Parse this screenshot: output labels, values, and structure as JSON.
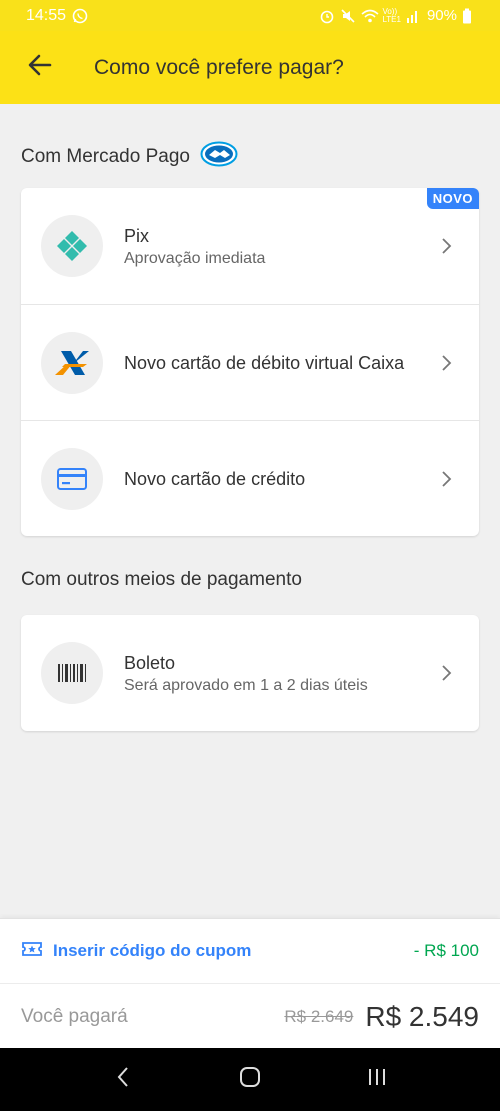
{
  "status_bar": {
    "time": "14:55",
    "battery": "90%",
    "signal_label": "Vo))\nLTE1"
  },
  "app_bar": {
    "title": "Como você prefere pagar?"
  },
  "mercado_pago_section": {
    "title": "Com Mercado Pago",
    "items": [
      {
        "title": "Pix",
        "subtitle": "Aprovação imediata",
        "badge": "NOVO",
        "icon": "pix-icon"
      },
      {
        "title": "Novo cartão de débito virtual Caixa",
        "icon": "caixa-icon"
      },
      {
        "title": "Novo cartão de crédito",
        "icon": "credit-card-icon"
      }
    ]
  },
  "other_section": {
    "title": "Com outros meios de pagamento",
    "items": [
      {
        "title": "Boleto",
        "subtitle": "Será aprovado em 1 a 2 dias úteis",
        "icon": "barcode-icon"
      }
    ]
  },
  "footer": {
    "coupon_label": "Inserir código do cupom",
    "discount": "- R$ 100",
    "pay_label": "Você pagará",
    "old_price": "R$ 2.649",
    "new_price": "R$ 2.549"
  },
  "colors": {
    "brand_yellow": "#fce116",
    "accent_blue": "#3483fa",
    "discount_green": "#00a650",
    "pix_teal": "#32bcad",
    "caixa_orange": "#f39200",
    "caixa_blue": "#005ca9"
  }
}
